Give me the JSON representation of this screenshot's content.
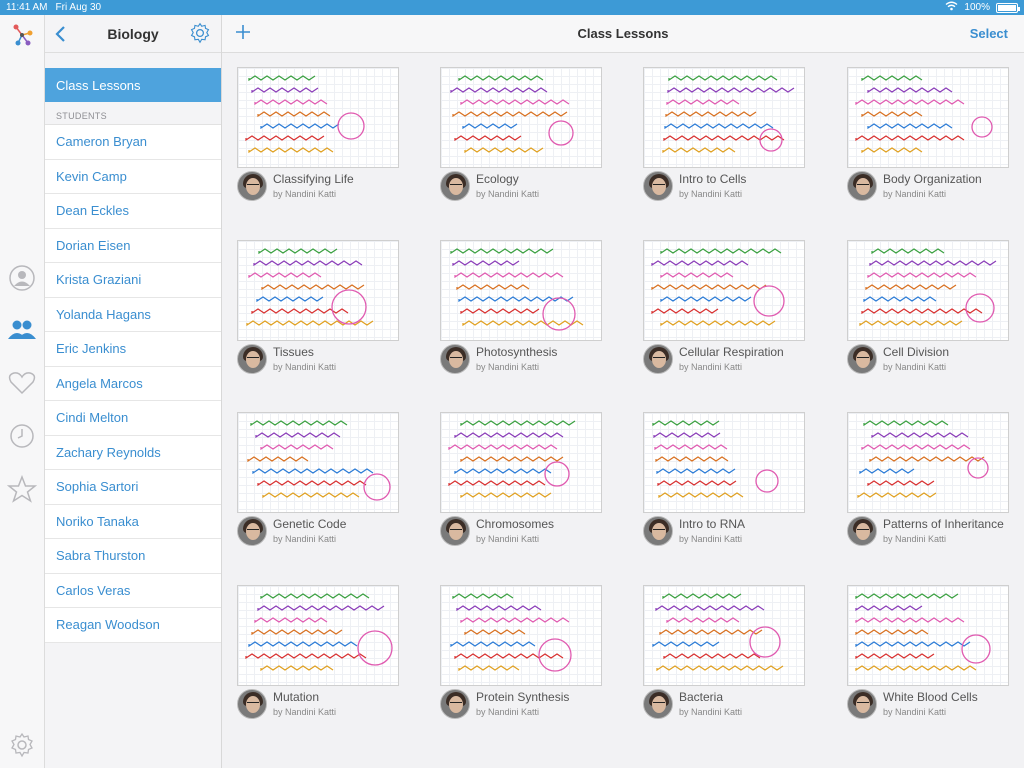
{
  "status_bar": {
    "time": "11:41 AM",
    "date": "Fri Aug 30",
    "battery": "100%",
    "battery_level": 1.0
  },
  "sidebar": {
    "title": "Biology",
    "selected": "Class Lessons",
    "section_header": "STUDENTS",
    "students": [
      "Cameron Bryan",
      "Kevin Camp",
      "Dean Eckles",
      "Dorian Eisen",
      "Krista Graziani",
      "Yolanda Hagans",
      "Eric Jenkins",
      "Angela Marcos",
      "Cindi Melton",
      "Zachary Reynolds",
      "Sophia Sartori",
      "Noriko Tanaka",
      "Sabra Thurston",
      "Carlos Veras",
      "Reagan Woodson"
    ]
  },
  "main": {
    "title": "Class Lessons",
    "add_icon": "plus-icon",
    "select_label": "Select",
    "lessons": [
      {
        "title": "Classifying Life",
        "author": "by Nandini Katti"
      },
      {
        "title": "Ecology",
        "author": "by Nandini Katti"
      },
      {
        "title": "Intro to Cells",
        "author": "by Nandini Katti"
      },
      {
        "title": "Body Organization",
        "author": "by Nandini Katti"
      },
      {
        "title": "Tissues",
        "author": "by Nandini Katti"
      },
      {
        "title": "Photosynthesis",
        "author": "by Nandini Katti"
      },
      {
        "title": "Cellular Respiration",
        "author": "by Nandini Katti"
      },
      {
        "title": "Cell Division",
        "author": "by Nandini Katti"
      },
      {
        "title": "Genetic Code",
        "author": "by Nandini Katti"
      },
      {
        "title": "Chromosomes",
        "author": "by Nandini Katti"
      },
      {
        "title": "Intro to RNA",
        "author": "by Nandini Katti"
      },
      {
        "title": "Patterns of Inheritance",
        "author": "by Nandini Katti"
      },
      {
        "title": "Mutation",
        "author": "by Nandini Katti"
      },
      {
        "title": "Protein Synthesis",
        "author": "by Nandini Katti"
      },
      {
        "title": "Bacteria",
        "author": "by Nandini Katti"
      },
      {
        "title": "White Blood Cells",
        "author": "by Nandini Katti"
      }
    ]
  },
  "rail_icons": [
    "app-logo-icon",
    "person-icon",
    "group-icon",
    "heart-icon",
    "clock-icon",
    "star-icon",
    "settings-gear-icon"
  ],
  "colors": {
    "accent": "#3a8ed0",
    "selected_row": "#4ea3dd",
    "status_bar": "#3d9ad6"
  }
}
